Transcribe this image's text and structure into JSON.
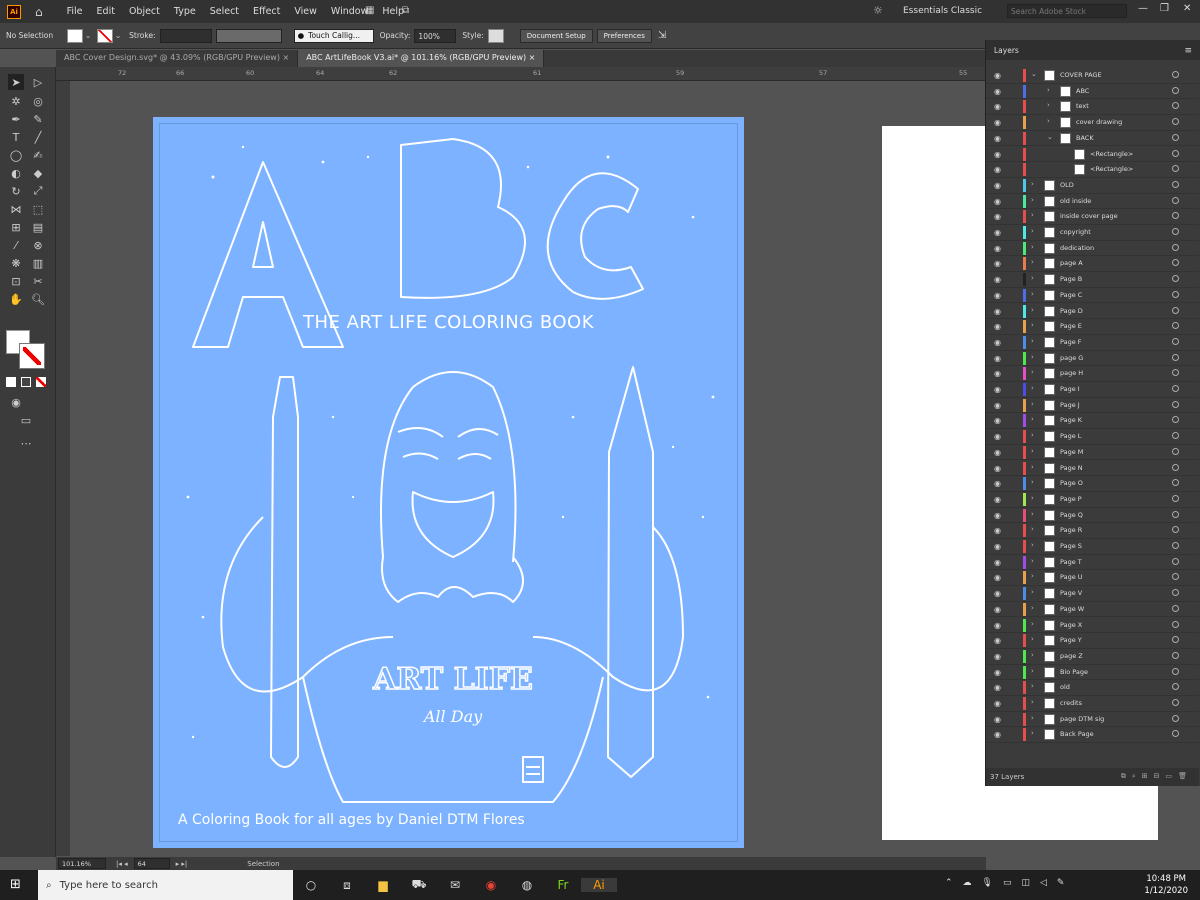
{
  "app": {
    "logo": "Ai"
  },
  "menus": [
    "File",
    "Edit",
    "Object",
    "Type",
    "Select",
    "Effect",
    "View",
    "Window",
    "Help"
  ],
  "topbar": {
    "workspace": "Essentials Classic",
    "search_placeholder": "Search Adobe Stock"
  },
  "control": {
    "selection": "No Selection",
    "stroke_label": "Stroke:",
    "brush": "Touch Callig...",
    "opacity_label": "Opacity:",
    "opacity": "100%",
    "style_label": "Style:",
    "doc_setup": "Document Setup",
    "preferences": "Preferences"
  },
  "tabs": [
    {
      "label": "ABC Cover Design.svg* @ 43.09% (RGB/GPU Preview)"
    },
    {
      "label": "ABC ArtLifeBook V3.ai* @ 101.16% (RGB/GPU Preview)"
    }
  ],
  "ruler": {
    "h": [
      "72",
      "66",
      "60",
      "64",
      "62",
      "61",
      "59",
      "57",
      "55"
    ]
  },
  "artwork": {
    "title": "THE ART LIFE COLORING BOOK",
    "letters": [
      "A",
      "B",
      "C"
    ],
    "shirt": "ART LIFE",
    "shirt_sub": "All Day",
    "footer": "A Coloring Book for all ages by Daniel DTM Flores"
  },
  "status": {
    "zoom": "101.16%",
    "page": "64",
    "tool": "Selection"
  },
  "layers_panel": {
    "title": "Layers",
    "count": "37 Layers",
    "rows": [
      {
        "name": "COVER PAGE",
        "color": "#e84d4d",
        "indent": 0,
        "open": true
      },
      {
        "name": "ABC",
        "color": "#4d6ee8",
        "indent": 1
      },
      {
        "name": "text",
        "color": "#e84d4d",
        "indent": 1
      },
      {
        "name": "cover drawing",
        "color": "#e8a04d",
        "indent": 1
      },
      {
        "name": "BACK",
        "color": "#e84d4d",
        "indent": 1,
        "open": true
      },
      {
        "name": "<Rectangle>",
        "color": "#e84d4d",
        "indent": 2
      },
      {
        "name": "<Rectangle>",
        "color": "#e84d4d",
        "indent": 2
      },
      {
        "name": "OLD",
        "color": "#4dc8e8",
        "indent": 0
      },
      {
        "name": "old inside",
        "color": "#4de8a0",
        "indent": 0
      },
      {
        "name": "inside cover page",
        "color": "#e84d4d",
        "indent": 0
      },
      {
        "name": "copyright",
        "color": "#4de8e8",
        "indent": 0
      },
      {
        "name": "dedication",
        "color": "#4de87a",
        "indent": 0
      },
      {
        "name": "page A",
        "color": "#e87a4d",
        "indent": 0
      },
      {
        "name": "Page B",
        "color": "#222222",
        "indent": 0
      },
      {
        "name": "Page C",
        "color": "#4d6ee8",
        "indent": 0
      },
      {
        "name": "Page D",
        "color": "#4de8e8",
        "indent": 0
      },
      {
        "name": "Page E",
        "color": "#e8a04d",
        "indent": 0
      },
      {
        "name": "Page F",
        "color": "#4d8be8",
        "indent": 0
      },
      {
        "name": "page G",
        "color": "#4de84d",
        "indent": 0
      },
      {
        "name": "page H",
        "color": "#e84dc8",
        "indent": 0
      },
      {
        "name": "Page I",
        "color": "#4d4de8",
        "indent": 0
      },
      {
        "name": "Page J",
        "color": "#e8a04d",
        "indent": 0
      },
      {
        "name": "Page K",
        "color": "#a04de8",
        "indent": 0
      },
      {
        "name": "Page L",
        "color": "#e84d4d",
        "indent": 0
      },
      {
        "name": "Page M",
        "color": "#e84d4d",
        "indent": 0
      },
      {
        "name": "Page N",
        "color": "#e84d4d",
        "indent": 0
      },
      {
        "name": "Page O",
        "color": "#4d8be8",
        "indent": 0
      },
      {
        "name": "Page P",
        "color": "#a0e84d",
        "indent": 0
      },
      {
        "name": "Page Q",
        "color": "#e84d7a",
        "indent": 0
      },
      {
        "name": "Page R",
        "color": "#e84d4d",
        "indent": 0
      },
      {
        "name": "Page S",
        "color": "#e84d4d",
        "indent": 0
      },
      {
        "name": "Page T",
        "color": "#a04de8",
        "indent": 0
      },
      {
        "name": "Page U",
        "color": "#e8a04d",
        "indent": 0
      },
      {
        "name": "Page V",
        "color": "#4d8be8",
        "indent": 0
      },
      {
        "name": "Page W",
        "color": "#e8a04d",
        "indent": 0
      },
      {
        "name": "Page X",
        "color": "#4de84d",
        "indent": 0
      },
      {
        "name": "Page Y",
        "color": "#e84d4d",
        "indent": 0
      },
      {
        "name": "page Z",
        "color": "#4de84d",
        "indent": 0
      },
      {
        "name": "Bio Page",
        "color": "#4de84d",
        "indent": 0
      },
      {
        "name": "old",
        "color": "#e84d4d",
        "indent": 0
      },
      {
        "name": "credits",
        "color": "#e84d4d",
        "indent": 0
      },
      {
        "name": "page DTM sig",
        "color": "#e84d4d",
        "indent": 0
      },
      {
        "name": "Back Page",
        "color": "#e84d4d",
        "indent": 0
      }
    ]
  },
  "taskbar": {
    "search_placeholder": "Type here to search",
    "time": "10:48 PM",
    "date": "1/12/2020"
  }
}
